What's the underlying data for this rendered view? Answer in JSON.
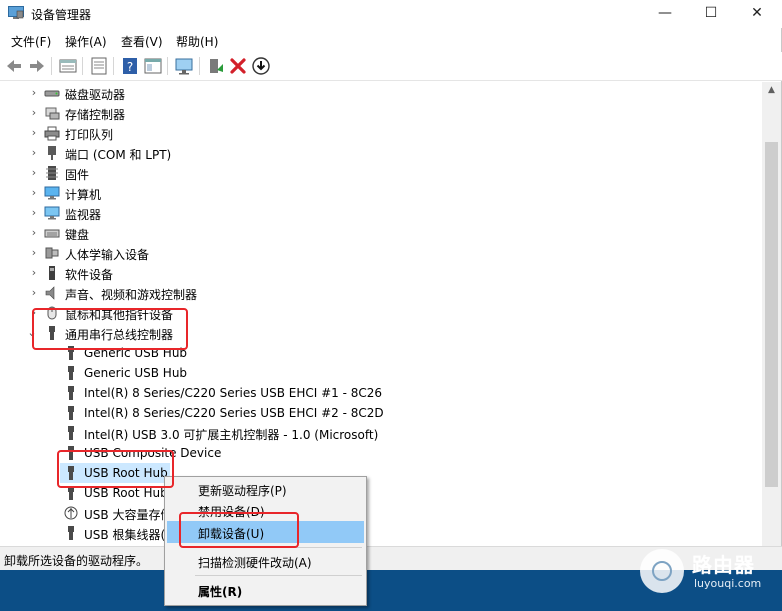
{
  "window": {
    "title": "设备管理器"
  },
  "titlebar": {
    "minimize": "—",
    "maximize": "☐",
    "close": "✕"
  },
  "menu": [
    "文件(F)",
    "操作(A)",
    "查看(V)",
    "帮助(H)"
  ],
  "toolbar_icons": [
    "back-icon",
    "forward-icon",
    "properties-view-icon",
    "list-view-icon",
    "help-icon",
    "details-view-icon",
    "monitor-icon",
    "update-driver-icon",
    "uninstall-icon",
    "download-icon"
  ],
  "tree": {
    "categories": [
      {
        "label": "磁盘驱动器",
        "icon": "disk-icon"
      },
      {
        "label": "存储控制器",
        "icon": "storage-icon"
      },
      {
        "label": "打印队列",
        "icon": "printer-icon"
      },
      {
        "label": "端口 (COM 和 LPT)",
        "icon": "port-icon"
      },
      {
        "label": "固件",
        "icon": "firmware-icon"
      },
      {
        "label": "计算机",
        "icon": "computer-icon"
      },
      {
        "label": "监视器",
        "icon": "monitor-icon"
      },
      {
        "label": "键盘",
        "icon": "keyboard-icon"
      },
      {
        "label": "人体学输入设备",
        "icon": "hid-icon"
      },
      {
        "label": "软件设备",
        "icon": "software-device-icon"
      },
      {
        "label": "声音、视频和游戏控制器",
        "icon": "sound-icon"
      },
      {
        "label": "鼠标和其他指针设备",
        "icon": "mouse-icon"
      }
    ],
    "usb_category": "通用串行总线控制器",
    "usb_children": [
      "Generic USB Hub",
      "Generic USB Hub",
      "Intel(R) 8 Series/C220 Series USB EHCI #1 - 8C26",
      "Intel(R) 8 Series/C220 Series USB EHCI #2 - 8C2D",
      "Intel(R) USB 3.0 可扩展主机控制器 - 1.0 (Microsoft)",
      "USB Composite Device",
      "USB Root Hub",
      "USB Root Hub",
      "USB 大容量存储",
      "USB 根集线器("
    ],
    "expand_glyph": "›",
    "collapse_glyph": "⌄"
  },
  "context_menu": {
    "update_driver": "更新驱动程序(P)",
    "disable": "禁用设备(D)",
    "uninstall": "卸载设备(U)",
    "scan": "扫描检测硬件改动(A)",
    "properties": "属性(R)"
  },
  "statusbar": {
    "text": "卸载所选设备的驱动程序。"
  },
  "scrollbar": {
    "up_arrow": "▲"
  },
  "watermark": {
    "title": "路由器",
    "url": "luyouqi.com"
  },
  "colors": {
    "selection": "#cce8ff",
    "menu_highlight": "#91c9f7",
    "annotation": "#e8262a",
    "taskbar": "#0c4e86"
  }
}
